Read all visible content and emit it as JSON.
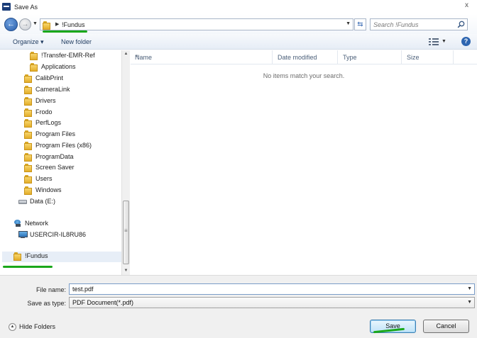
{
  "window": {
    "title": "Save As",
    "close_glyph": "x"
  },
  "address": {
    "crumb": "!Fundus",
    "search_placeholder": "Search !Fundus"
  },
  "toolbar": {
    "organize_label": "Organize ▾",
    "new_folder_label": "New folder",
    "help_glyph": "?"
  },
  "nav": {
    "items": [
      {
        "label": "!Transfer-EMR-Ref",
        "icon": "folder-icon"
      },
      {
        "label": "Applications",
        "icon": "folder-icon"
      },
      {
        "label": "CalibPrint",
        "icon": "folder-icon"
      },
      {
        "label": "CameraLink",
        "icon": "folder-icon"
      },
      {
        "label": "Drivers",
        "icon": "folder-icon"
      },
      {
        "label": "Frodo",
        "icon": "folder-icon"
      },
      {
        "label": "PerfLogs",
        "icon": "folder-icon"
      },
      {
        "label": "Program Files",
        "icon": "folder-icon"
      },
      {
        "label": "Program Files (x86)",
        "icon": "folder-icon"
      },
      {
        "label": "ProgramData",
        "icon": "folder-icon"
      },
      {
        "label": "Screen Saver",
        "icon": "folder-icon"
      },
      {
        "label": "Users",
        "icon": "folder-icon"
      },
      {
        "label": "Windows",
        "icon": "folder-icon"
      }
    ],
    "drive_label": "Data (E:)",
    "network_label": "Network",
    "computer_label": "USERCIR-IL8RU86",
    "selected_label": "!Fundus"
  },
  "content": {
    "columns": [
      "Name",
      "Date modified",
      "Type",
      "Size"
    ],
    "empty_message": "No items match your search."
  },
  "form": {
    "file_name_label": "File name:",
    "file_name_value": "test.pdf",
    "save_type_label": "Save as type:",
    "save_type_value": "PDF Document(*.pdf)"
  },
  "footer": {
    "hide_folders_label": "Hide Folders",
    "save_label": "Save",
    "cancel_label": "Cancel"
  },
  "colors": {
    "highlight_mark": "#1aa81a",
    "accent": "#2a5fab"
  }
}
